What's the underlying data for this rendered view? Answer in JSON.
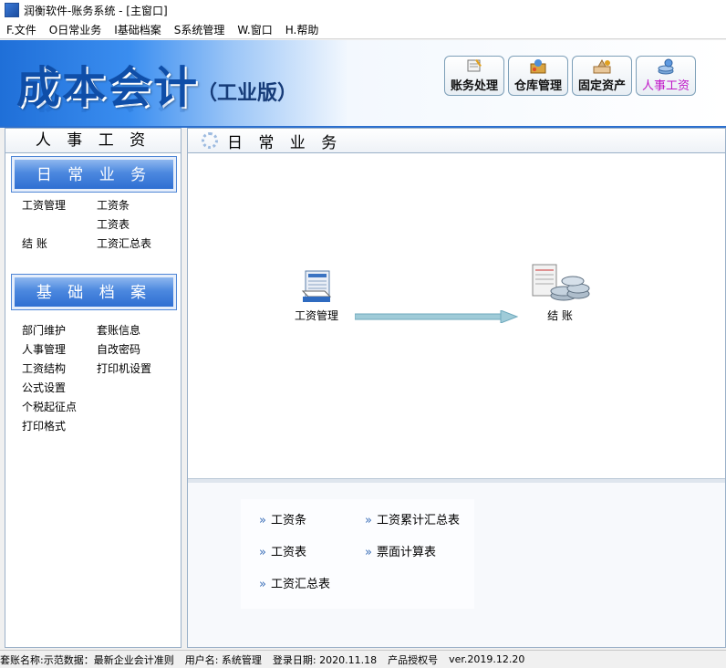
{
  "window": {
    "title": "润衡软件-账务系统 - [主窗口]"
  },
  "menu": [
    "F.文件",
    "O日常业务",
    "I基础档案",
    "S系统管理",
    "W.窗口",
    "H.帮助"
  ],
  "banner": {
    "logo": "成本会计",
    "edition": "（工业版）"
  },
  "modules": [
    {
      "label": "账务处理",
      "icon": "ledger-icon"
    },
    {
      "label": "仓库管理",
      "icon": "warehouse-icon"
    },
    {
      "label": "固定资产",
      "icon": "assets-icon"
    },
    {
      "label": "人事工资",
      "icon": "payroll-icon",
      "active": true,
      "color": "#c016c8"
    }
  ],
  "left_panel": {
    "title": "人 事 工 资",
    "daily": {
      "title": "日 常 业 务",
      "links": [
        "工资管理",
        "工资条",
        "",
        "工资表",
        "结 账",
        "工资汇总表"
      ]
    },
    "archive": {
      "title": "基 础 档 案",
      "links": [
        "部门维护",
        "套账信息",
        "人事管理",
        "自改密码",
        "工资结构",
        "打印机设置",
        "公式设置",
        "",
        "个税起征点",
        "",
        "打印格式",
        ""
      ]
    }
  },
  "right_panel": {
    "title": "日 常 业 务",
    "flow": {
      "from": "工资管理",
      "to": "结 账"
    },
    "links": [
      "工资条",
      "工资累计汇总表",
      "工资表",
      "票面计算表",
      "工资汇总表"
    ]
  },
  "status": {
    "account": "套账名称:示范数据：最新企业会计准则",
    "user": "用户名: 系统管理",
    "date": "登录日期: 2020.11.18",
    "license": "产品授权号",
    "version": "ver.2019.12.20"
  },
  "colors": {
    "accent": "#2f6fd2",
    "active_module": "#c016c8"
  }
}
